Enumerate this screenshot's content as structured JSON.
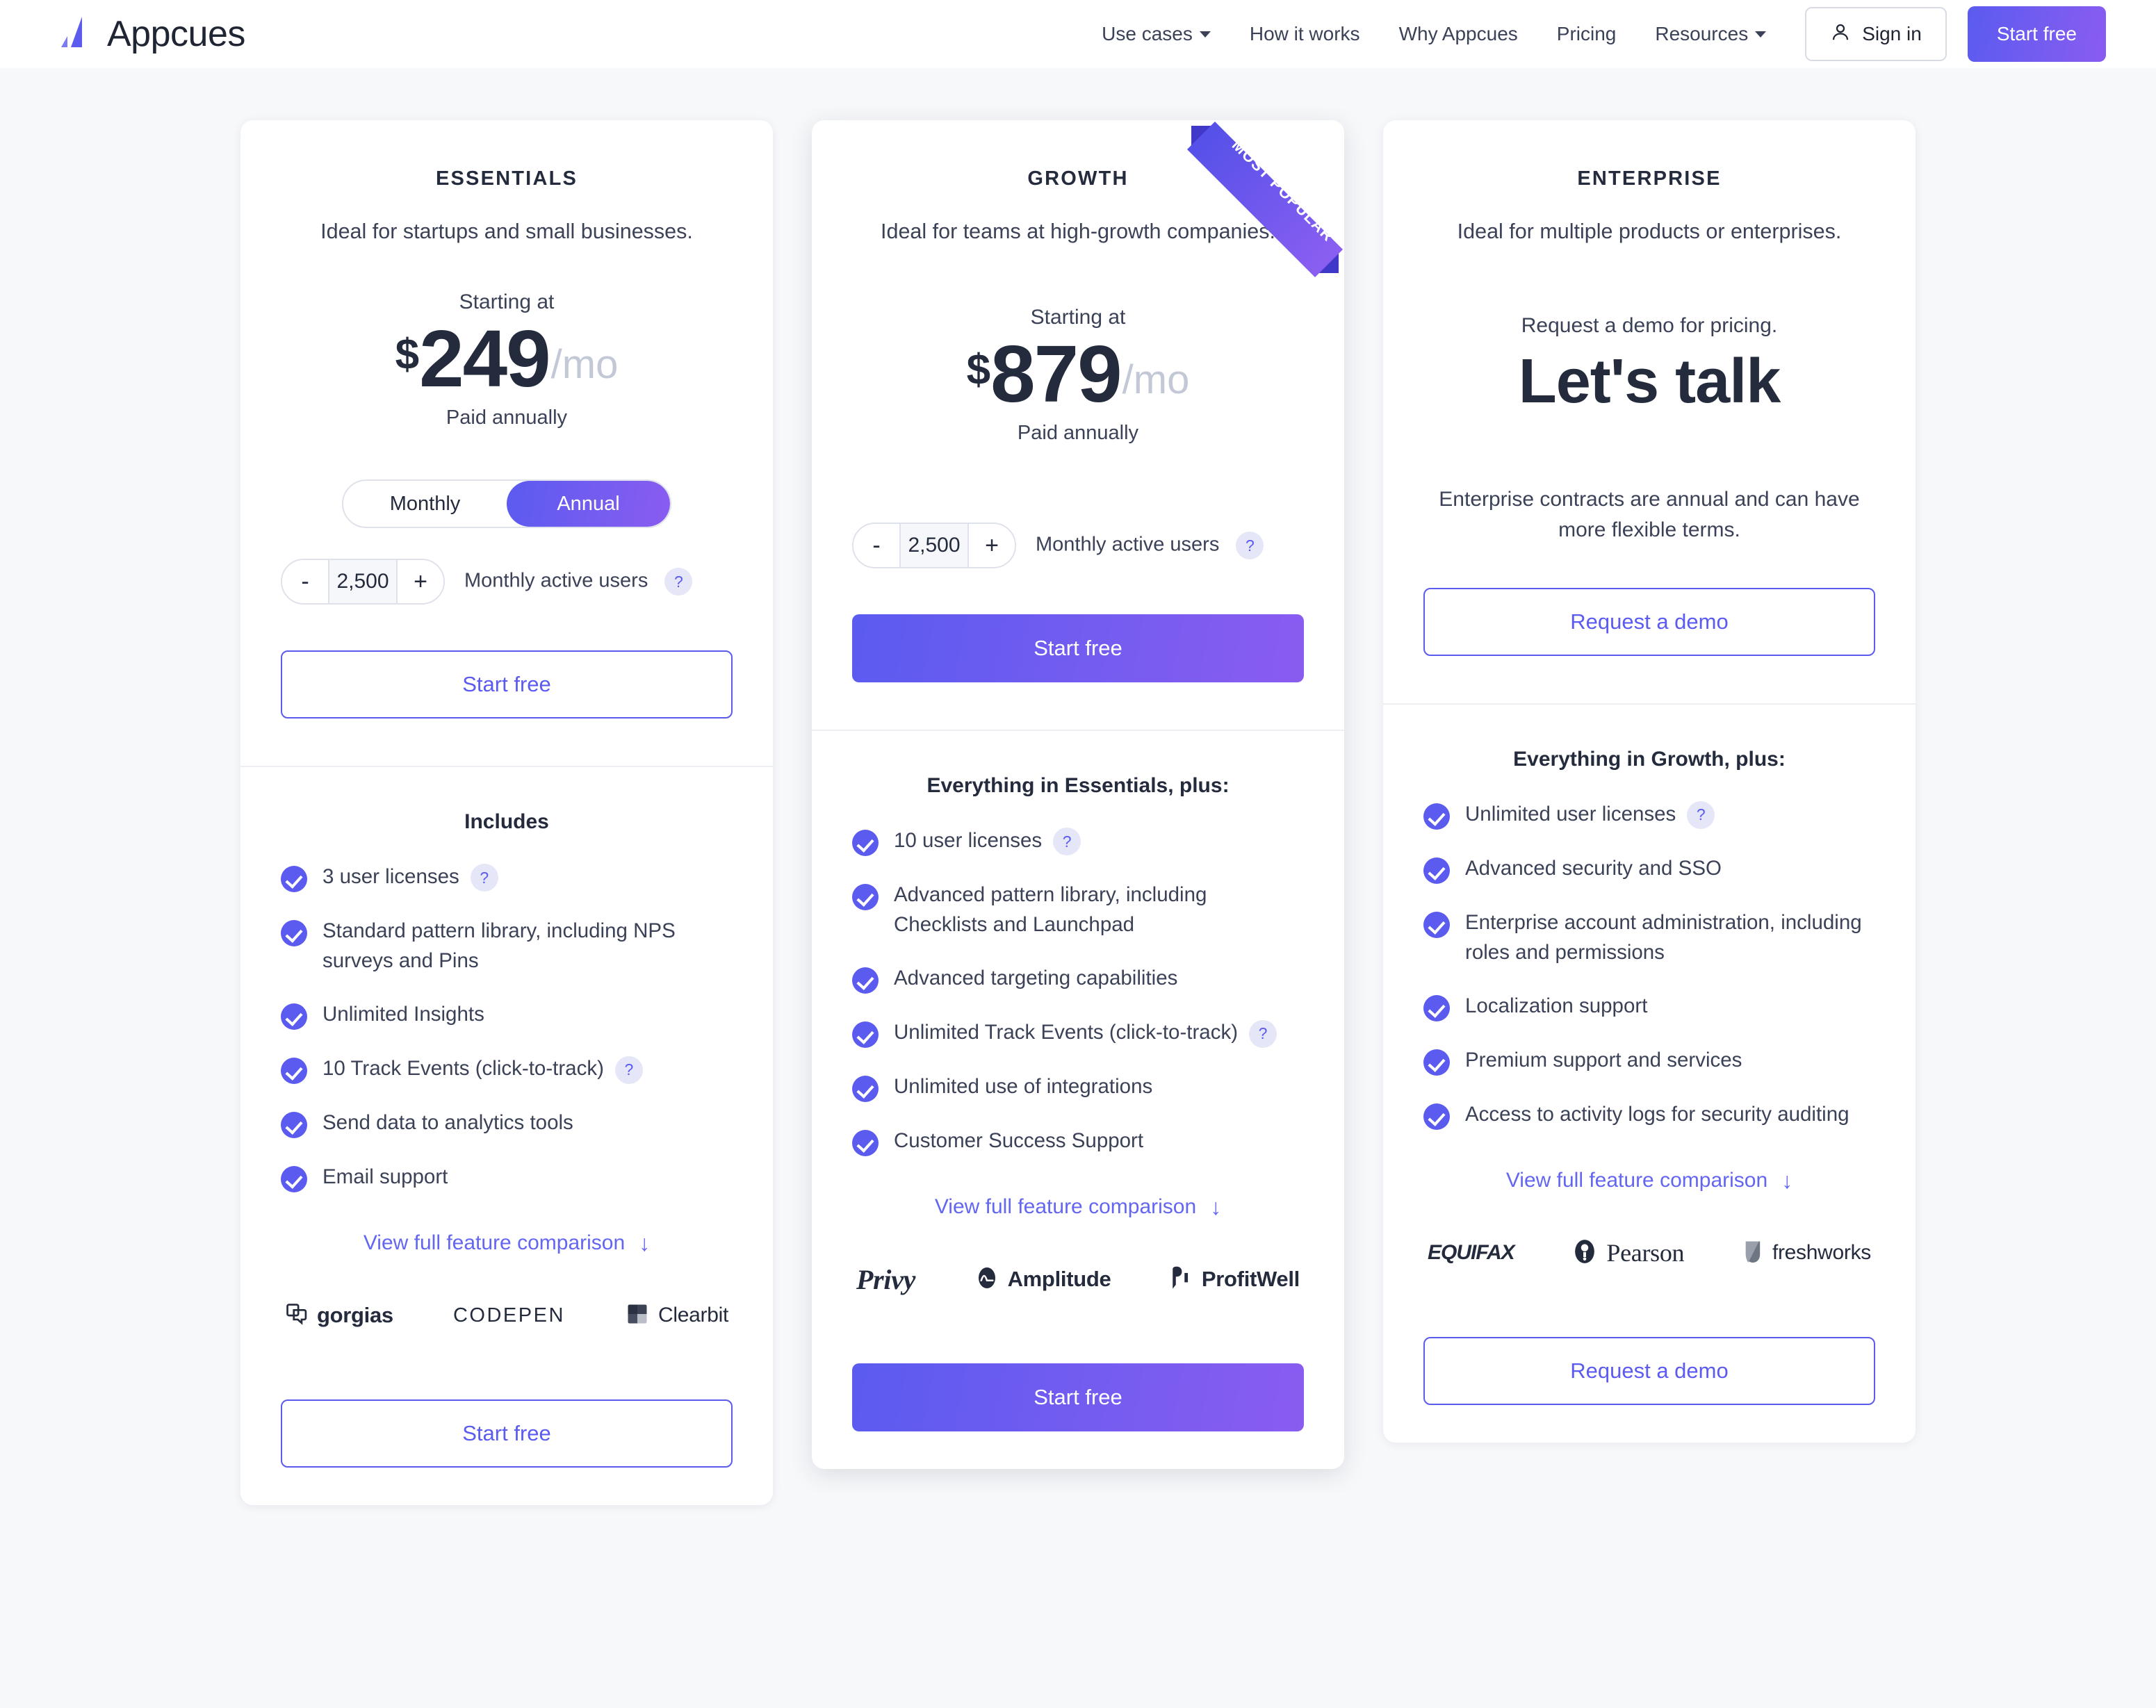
{
  "header": {
    "brand": "Appcues",
    "nav": [
      {
        "label": "Use cases",
        "has_caret": true
      },
      {
        "label": "How it works",
        "has_caret": false
      },
      {
        "label": "Why Appcues",
        "has_caret": false
      },
      {
        "label": "Pricing",
        "has_caret": false
      },
      {
        "label": "Resources",
        "has_caret": true
      }
    ],
    "sign_in": "Sign in",
    "start_free": "Start free"
  },
  "accent": {
    "primary": "#5b5bf0",
    "gradient_end": "#8a5cf0",
    "text_dark": "#242b3d",
    "text_body": "#3b4257",
    "muted": "#c3c8d6"
  },
  "plans": [
    {
      "name": "ESSENTIALS",
      "description": "Ideal for startups and small businesses.",
      "starting_at": "Starting at",
      "currency": "$",
      "amount": "249",
      "per": "/mo",
      "paid_note": "Paid annually",
      "billing_toggle": {
        "monthly": "Monthly",
        "annual": "Annual",
        "selected": "Annual"
      },
      "stepper": {
        "minus": "-",
        "value": "2,500",
        "plus": "+",
        "label": "Monthly active users",
        "help": "?"
      },
      "cta_top": "Start free",
      "cta_bottom": "Start free",
      "features_title": "Includes",
      "features": [
        {
          "text": "3 user licenses",
          "help": "?"
        },
        {
          "text": "Standard pattern library, including NPS surveys and Pins",
          "help": ""
        },
        {
          "text": "Unlimited Insights",
          "help": ""
        },
        {
          "text": "10 Track Events (click-to-track)",
          "help": "?"
        },
        {
          "text": "Send data to analytics tools",
          "help": ""
        },
        {
          "text": "Email support",
          "help": ""
        }
      ],
      "compare_link": "View full feature comparison",
      "compare_arrow": "↓",
      "logos": [
        "gorgias",
        "CODEPEN",
        "Clearbit"
      ]
    },
    {
      "name": "GROWTH",
      "description": "Ideal for teams at high-growth companies.",
      "badge": "MOST POPULAR",
      "starting_at": "Starting at",
      "currency": "$",
      "amount": "879",
      "per": "/mo",
      "paid_note": "Paid annually",
      "stepper": {
        "minus": "-",
        "value": "2,500",
        "plus": "+",
        "label": "Monthly active users",
        "help": "?"
      },
      "cta_top": "Start free",
      "cta_bottom": "Start free",
      "features_title": "Everything in Essentials, plus:",
      "features": [
        {
          "text": "10 user licenses",
          "help": "?"
        },
        {
          "text": "Advanced pattern library, including Checklists and Launchpad",
          "help": ""
        },
        {
          "text": "Advanced targeting capabilities",
          "help": ""
        },
        {
          "text": "Unlimited Track Events (click-to-track)",
          "help": "?"
        },
        {
          "text": "Unlimited use of integrations",
          "help": ""
        },
        {
          "text": "Customer Success Support",
          "help": ""
        }
      ],
      "compare_link": "View full feature comparison",
      "compare_arrow": "↓",
      "logos": [
        "Privy",
        "Amplitude",
        "ProfitWell"
      ]
    },
    {
      "name": "ENTERPRISE",
      "description": "Ideal for multiple products or enterprises.",
      "lets_talk_lead": "Request a demo for pricing.",
      "lets_talk_big": "Let's talk",
      "terms": "Enterprise contracts are annual and can have more flexible terms.",
      "cta_top": "Request a demo",
      "cta_bottom": "Request a demo",
      "features_title": "Everything in Growth, plus:",
      "features": [
        {
          "text": "Unlimited user licenses",
          "help": "?"
        },
        {
          "text": "Advanced security and SSO",
          "help": ""
        },
        {
          "text": "Enterprise account administration, including roles and permissions",
          "help": ""
        },
        {
          "text": "Localization support",
          "help": ""
        },
        {
          "text": "Premium support and services",
          "help": ""
        },
        {
          "text": "Access to activity logs for security auditing",
          "help": ""
        }
      ],
      "compare_link": "View full feature comparison",
      "compare_arrow": "↓",
      "logos": [
        "EQUIFAX",
        "Pearson",
        "freshworks"
      ]
    }
  ]
}
